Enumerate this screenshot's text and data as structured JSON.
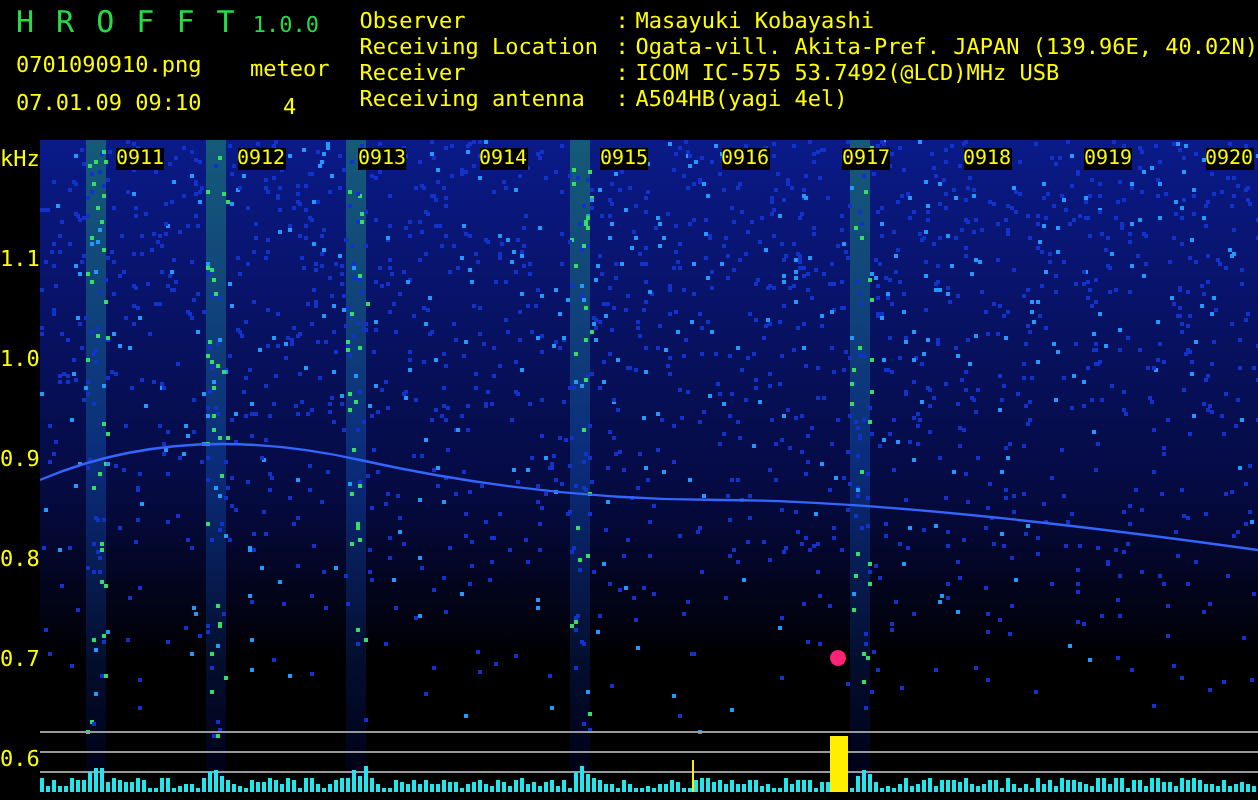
{
  "header": {
    "app_title": "H R O F F T",
    "version": "1.0.0",
    "file_name": "0701090910.png",
    "date_time": "07.01.09 09:10",
    "count_label": "meteor",
    "count": "4"
  },
  "info": [
    {
      "label": "Observer",
      "separator": ":",
      "value": "Masayuki Kobayashi"
    },
    {
      "label": "Receiving Location",
      "separator": ":",
      "value": "Ogata-vill. Akita-Pref. JAPAN (139.96E, 40.02N)"
    },
    {
      "label": "Receiver",
      "separator": ":",
      "value": "ICOM IC-575 53.7492(@LCD)MHz USB"
    },
    {
      "label": "Receiving antenna",
      "separator": ":",
      "value": "A504HB(yagi 4el)"
    }
  ],
  "plot": {
    "unit": "kHz",
    "y_labels": [
      "1.1",
      "1.0",
      "0.9",
      "0.8",
      "0.7",
      "0.6"
    ],
    "time_labels": [
      "0911",
      "0912",
      "0913",
      "0914",
      "0915",
      "0916",
      "0917",
      "0918",
      "0919",
      "0920"
    ]
  }
}
